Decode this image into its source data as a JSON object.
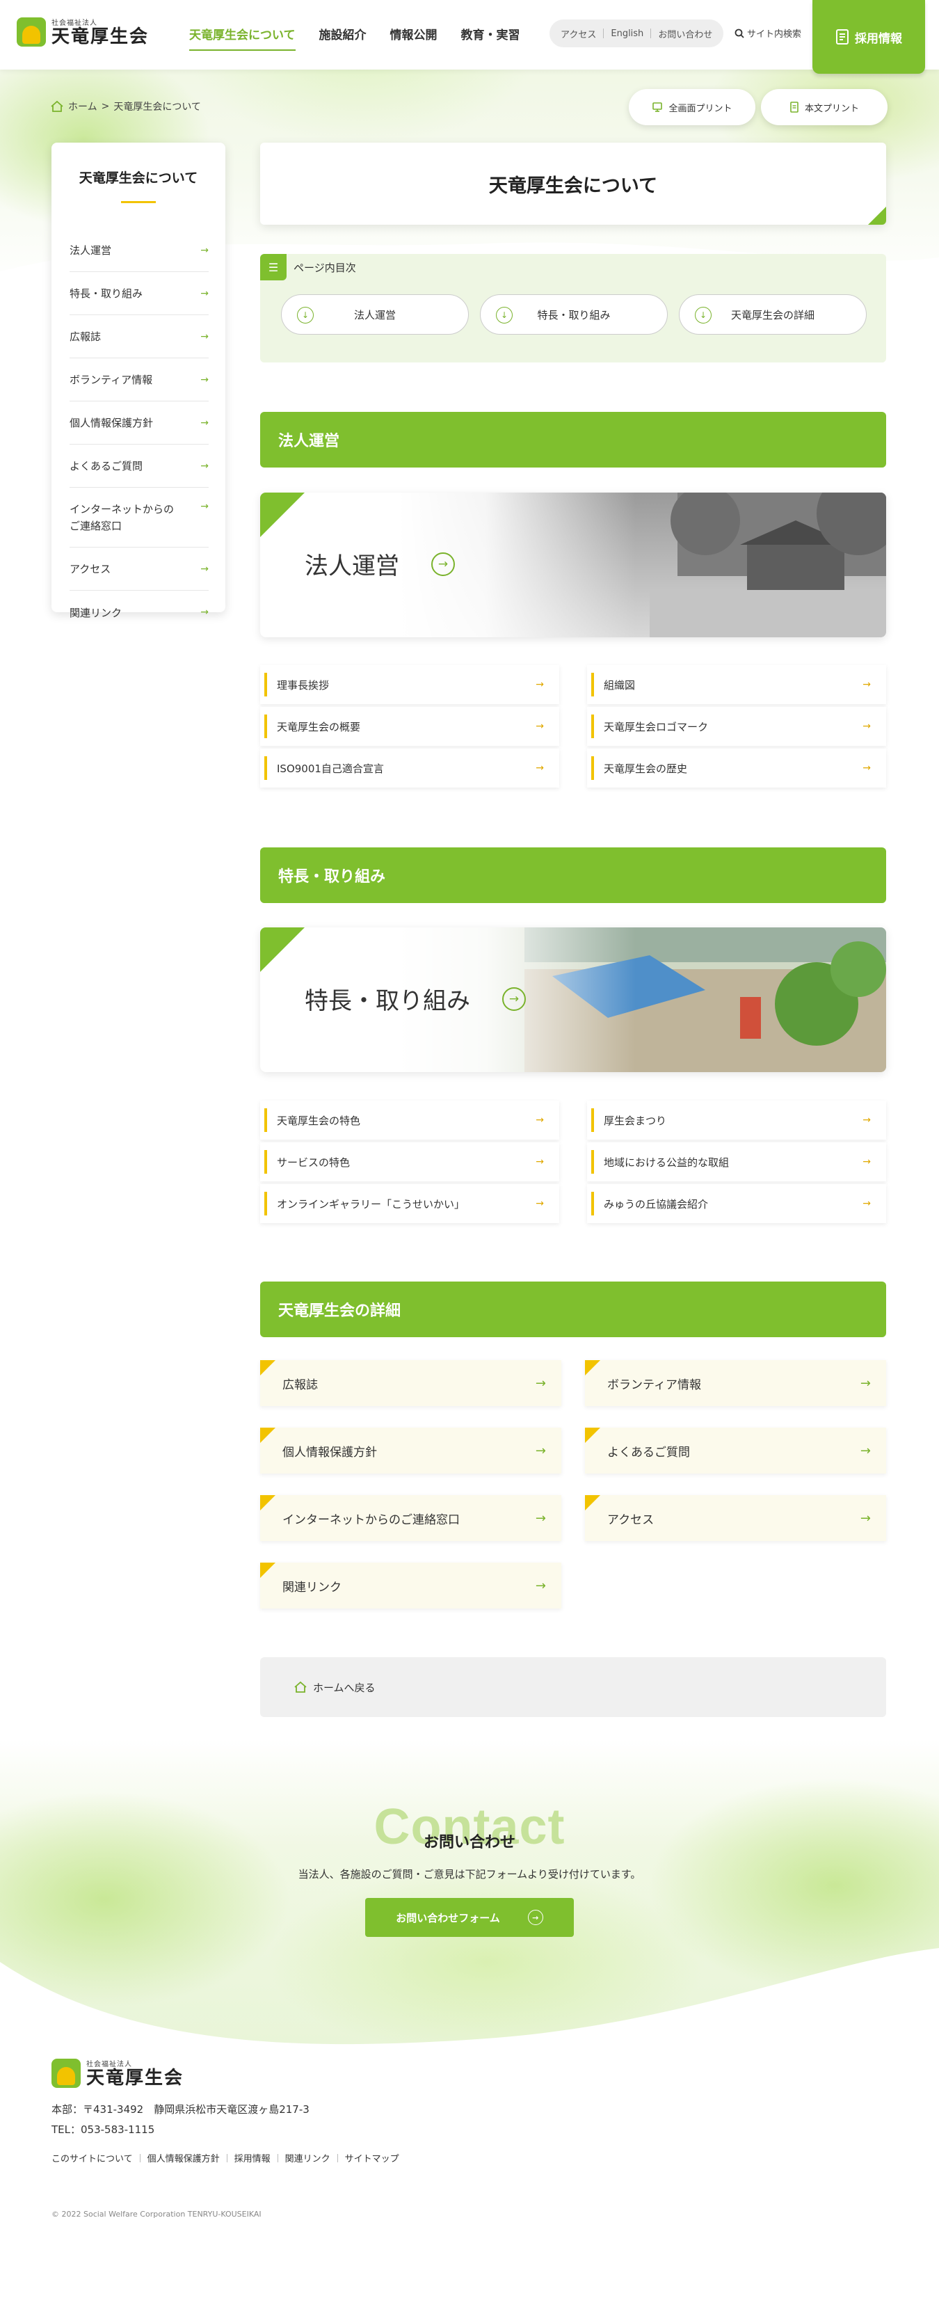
{
  "header": {
    "logo_sub": "社会福祉法人",
    "logo_main": "天竜厚生会",
    "nav": [
      "天竜厚生会について",
      "施設紹介",
      "情報公開",
      "教育・実習"
    ],
    "subnav": [
      "アクセス",
      "English",
      "お問い合わせ"
    ],
    "search_label": "サイト内検索",
    "recruit_label": "採用情報"
  },
  "breadcrumb": {
    "home": "ホーム",
    "sep": ">",
    "current": "天竜厚生会について"
  },
  "print": {
    "full": "全画面プリント",
    "text": "本文プリント"
  },
  "sidebar": {
    "title": "天竜厚生会について",
    "items": [
      "法人運営",
      "特長・取り組み",
      "広報誌",
      "ボランティア情報",
      "個人情報保護方針",
      "よくあるご質問",
      "インターネットからの\nご連絡窓口",
      "アクセス",
      "関連リンク"
    ]
  },
  "page_title": "天竜厚生会について",
  "toc": {
    "label": "ページ内目次",
    "items": [
      "法人運営",
      "特長・取り組み",
      "天竜厚生会の詳細"
    ]
  },
  "sections": {
    "houjin": {
      "heading": "法人運営",
      "banner": "法人運営",
      "links_left": [
        "理事長挨拶",
        "天竜厚生会の概要",
        "ISO9001自己適合宣言"
      ],
      "links_right": [
        "組織図",
        "天竜厚生会ロゴマーク",
        "天竜厚生会の歴史"
      ]
    },
    "tokucho": {
      "heading": "特長・取り組み",
      "banner": "特長・取り組み",
      "links_left": [
        "天竜厚生会の特色",
        "サービスの特色",
        "オンラインギャラリー「こうせいかい」"
      ],
      "links_right": [
        "厚生会まつり",
        "地域における公益的な取組",
        "みゅうの丘協議会紹介"
      ]
    },
    "detail": {
      "heading": "天竜厚生会の詳細",
      "cards": [
        "広報誌",
        "ボランティア情報",
        "個人情報保護方針",
        "よくあるご質問",
        "インターネットからのご連絡窓口",
        "アクセス",
        "関連リンク"
      ]
    }
  },
  "home_back": "ホームへ戻る",
  "contact": {
    "big": "Contact",
    "title": "お問い合わせ",
    "desc": "当法人、各施設のご質問・ご意見は下記フォームより受け付けています。",
    "button": "お問い合わせフォーム"
  },
  "footer": {
    "logo_sub": "社会福祉法人",
    "logo_main": "天竜厚生会",
    "address": "本部：〒431-3492　静岡県浜松市天竜区渡ヶ島217-3",
    "tel": "TEL：053-583-1115",
    "links": [
      "このサイトについて",
      "個人情報保護方針",
      "採用情報",
      "関連リンク",
      "サイトマップ"
    ],
    "copyright": "© 2022 Social Welfare Corporation TENRYU-KOUSEIKAI"
  },
  "colors": {
    "accent": "#7fbf2e",
    "yellow": "#f2c300"
  }
}
